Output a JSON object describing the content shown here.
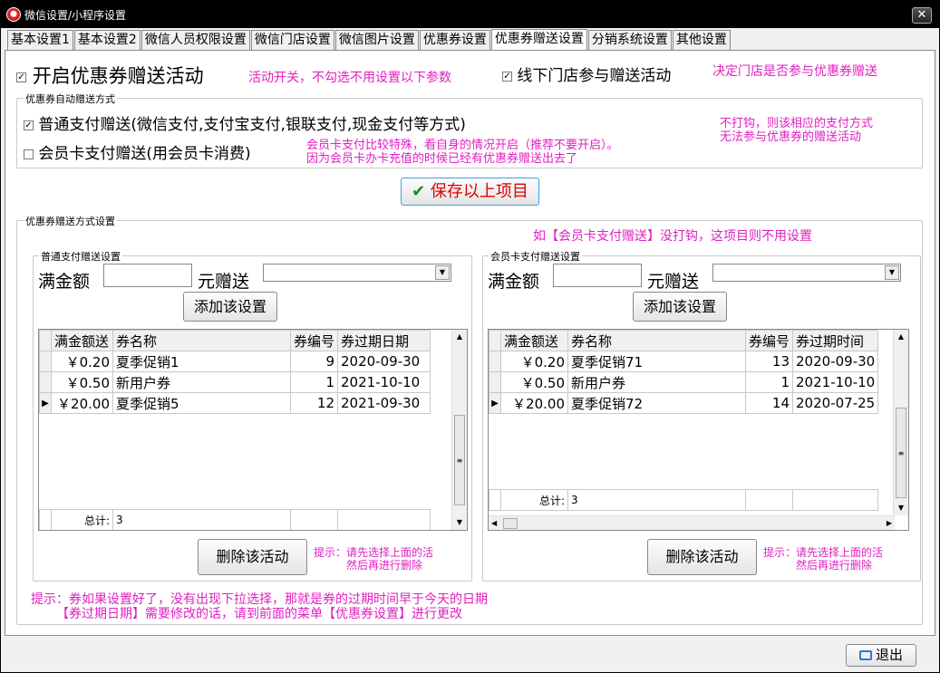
{
  "window": {
    "title": "微信设置/小程序设置",
    "close_glyph": "✕"
  },
  "tabs": [
    "基本设置1",
    "基本设置2",
    "微信人员权限设置",
    "微信门店设置",
    "微信图片设置",
    "优惠券设置",
    "优惠券赠送设置",
    "分销系统设置",
    "其他设置"
  ],
  "active_tab": "优惠券赠送设置",
  "enable": {
    "checked": true,
    "label": "开启优惠券赠送活动",
    "note": "活动开关，不勾选不用设置以下参数"
  },
  "offline": {
    "checked": true,
    "label": "线下门店参与赠送活动",
    "note": "决定门店是否参与优惠券赠送"
  },
  "auto_group": {
    "title": "优惠券自动赠送方式",
    "normal": {
      "checked": true,
      "label": "普通支付赠送(微信支付,支付宝支付,银联支付,现金支付等方式)"
    },
    "member": {
      "checked": false,
      "label": "会员卡支付赠送(用会员卡消费)"
    },
    "member_note1": "会员卡支付比较特殊，看自身的情况开启（推荐不要开启）。",
    "member_note2": "因为会员卡办卡充值的时候已经有优惠券赠送出去了",
    "right_note1": "不打钩，则该相应的支付方式",
    "right_note2": "无法参与优惠券的赠送活动"
  },
  "save_button": {
    "icon": "✔",
    "label": "保存以上项目"
  },
  "method_group": {
    "title": "优惠券赠送方式设置",
    "note": "如【会员卡支付赠送】没打钩，这项目则不用设置"
  },
  "normal_panel": {
    "title": "普通支付赠送设置",
    "amount_label": "满金额",
    "amount_value": "",
    "gift_label": "元赠送",
    "gift_value": "",
    "add_button": "添加该设置",
    "columns": [
      "满金额送",
      "券名称",
      "券编号",
      "券过期日期"
    ],
    "rows": [
      [
        "￥0.20",
        "夏季促销1",
        "9",
        "2020-09-30"
      ],
      [
        "￥0.50",
        "新用户券",
        "1",
        "2021-10-10"
      ],
      [
        "￥20.00",
        "夏季促销5",
        "12",
        "2021-09-30"
      ]
    ],
    "current_row": 2,
    "total_label": "总计:",
    "total_value": "3",
    "delete_button": "删除该活动",
    "hint1": "提示：请先选择上面的活",
    "hint2": "然后再进行删除"
  },
  "member_panel": {
    "title": "会员卡支付赠送设置",
    "amount_label": "满金额",
    "amount_value": "",
    "gift_label": "元赠送",
    "gift_value": "",
    "add_button": "添加该设置",
    "columns": [
      "满金额送",
      "券名称",
      "券编号",
      "券过期时间"
    ],
    "rows": [
      [
        "￥0.20",
        "夏季促销71",
        "13",
        "2020-09-30"
      ],
      [
        "￥0.50",
        "新用户券",
        "1",
        "2021-10-10"
      ],
      [
        "￥20.00",
        "夏季促销72",
        "14",
        "2020-07-25"
      ]
    ],
    "current_row": 2,
    "total_label": "总计:",
    "total_value": "3",
    "delete_button": "删除该活动",
    "hint1": "提示：请先选择上面的活",
    "hint2": "然后再进行删除"
  },
  "bottom_hint1": "提示：券如果设置好了，没有出现下拉选择，那就是券的过期时间早于今天的日期",
  "bottom_hint2": "【券过期日期】需要修改的话，请到前面的菜单【优惠券设置】进行更改",
  "exit_button": {
    "label": "退出"
  },
  "colors": {
    "note": "#e020c0",
    "title_bg": "#000000",
    "save_text": "#e00000",
    "save_border": "#40a0e0",
    "check": "#1a8a2a"
  }
}
